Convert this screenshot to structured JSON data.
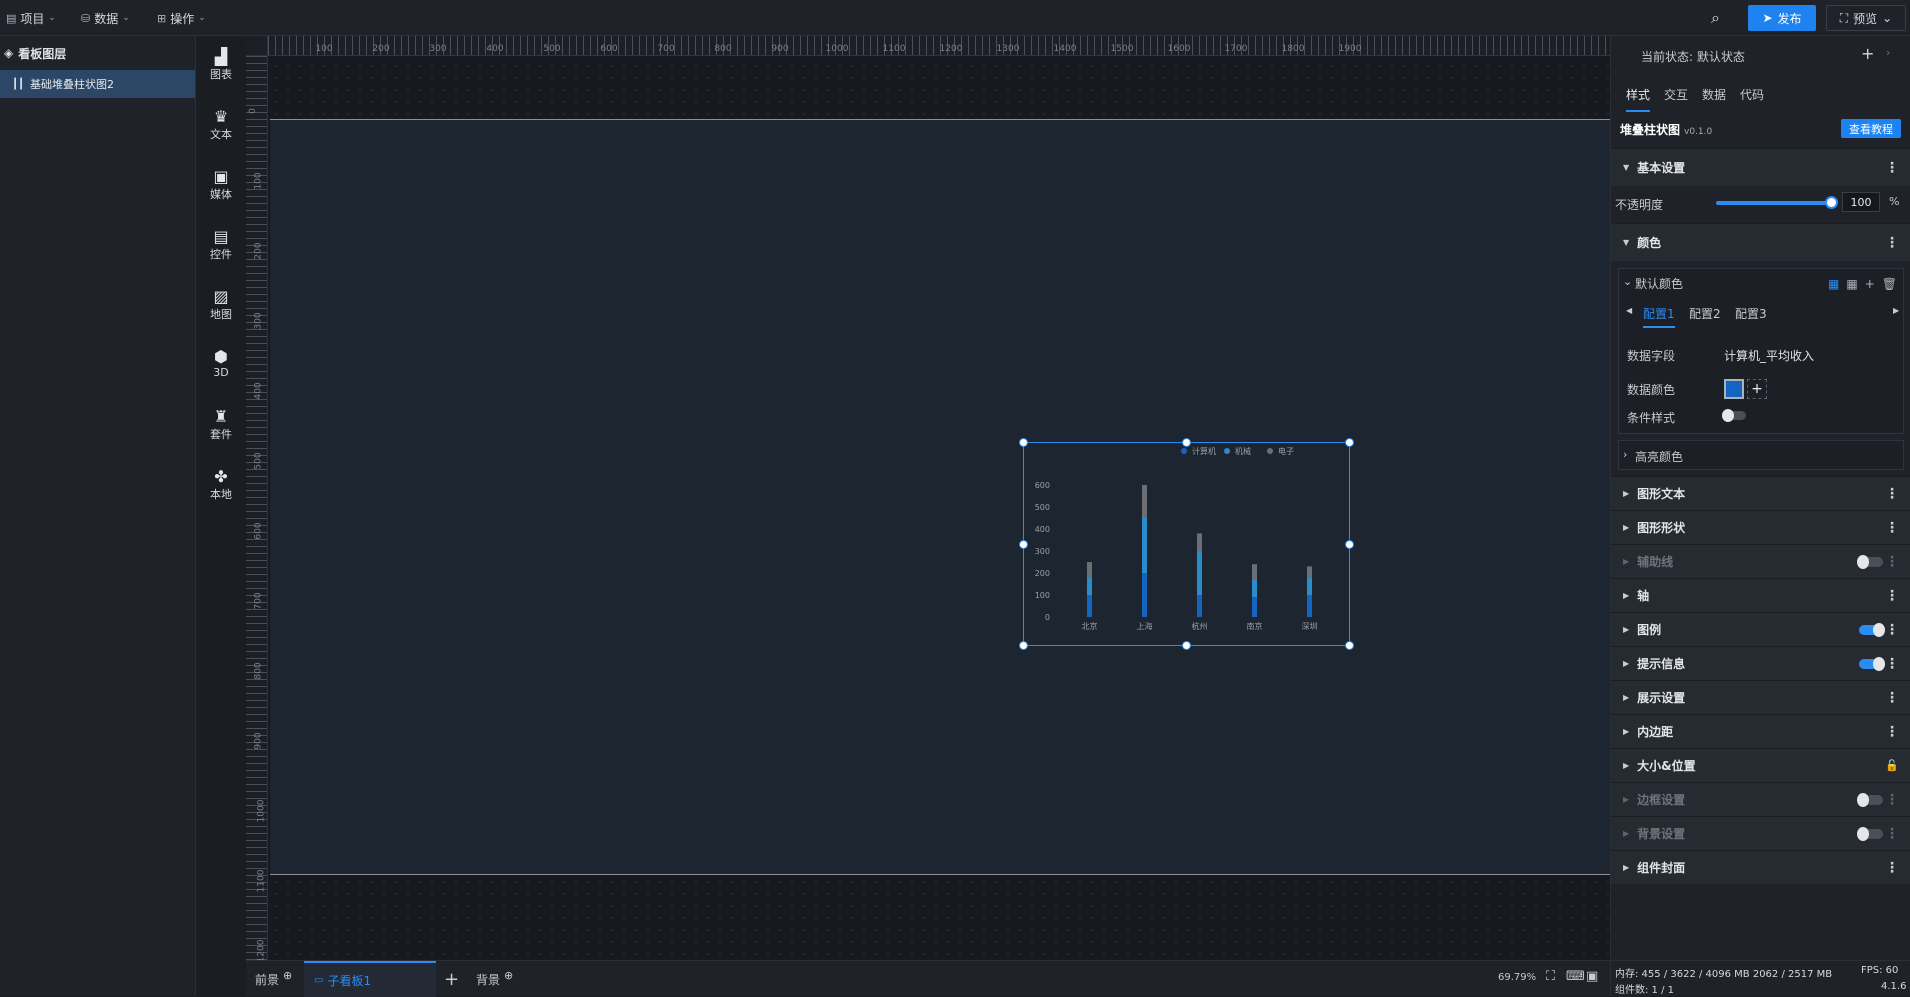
{
  "topbar": {
    "menu": [
      {
        "label": "项目"
      },
      {
        "label": "数据"
      },
      {
        "label": "操作"
      }
    ],
    "publish_label": "发布",
    "preview_label": "预览"
  },
  "left_panel": {
    "title": "看板图层",
    "layers": [
      {
        "label": "基础堆叠柱状图2"
      }
    ]
  },
  "tools": [
    {
      "label": "图表",
      "icon": "bar-chart-icon"
    },
    {
      "label": "文本",
      "icon": "text-icon"
    },
    {
      "label": "媒体",
      "icon": "media-icon"
    },
    {
      "label": "控件",
      "icon": "widget-icon"
    },
    {
      "label": "地图",
      "icon": "map-icon"
    },
    {
      "label": "3D",
      "icon": "cube-icon"
    },
    {
      "label": "套件",
      "icon": "shirt-icon"
    },
    {
      "label": "本地",
      "icon": "puzzle-icon"
    }
  ],
  "rulers": {
    "horizontal": [
      "100",
      "200",
      "300",
      "400",
      "500",
      "600",
      "700",
      "800",
      "900",
      "1000",
      "1100",
      "1200",
      "1300",
      "1400",
      "1500",
      "1600",
      "1700",
      "1800",
      "1900"
    ],
    "vertical": [
      "0",
      "100",
      "200",
      "300",
      "400",
      "500",
      "600",
      "700",
      "800",
      "900",
      "1000",
      "1100",
      "1200"
    ]
  },
  "chart_data": {
    "type": "bar",
    "stacked": true,
    "categories": [
      "北京",
      "上海",
      "杭州",
      "南京",
      "深圳"
    ],
    "series": [
      {
        "name": "计算机",
        "values": [
          100,
          200,
          100,
          90,
          100
        ],
        "color": "#1565c0"
      },
      {
        "name": "机械",
        "values": [
          80,
          250,
          200,
          80,
          80
        ],
        "color": "#2a8cc8"
      },
      {
        "name": "电子",
        "values": [
          70,
          150,
          80,
          70,
          50
        ],
        "color": "#6b6e73"
      }
    ],
    "yticks": [
      "0",
      "100",
      "200",
      "300",
      "400",
      "500",
      "600"
    ],
    "ylim": [
      0,
      600
    ],
    "legend_position": "top-right",
    "grid": false
  },
  "bottom": {
    "tabs": [
      {
        "label": "前景"
      },
      {
        "label": "子看板1"
      },
      {
        "label": "背景"
      }
    ],
    "zoom": "69.79%",
    "memory": "内存: 455 / 3622 / 4096 MB  2062 / 2517 MB",
    "fps": "FPS: 60",
    "components": "组件数: 1 / 1",
    "version": "4.1.6"
  },
  "right_panel": {
    "state": "当前状态: 默认状态",
    "tabs": [
      "样式",
      "交互",
      "数据",
      "代码"
    ],
    "component_name": "堆叠柱状图",
    "component_version": "v0.1.0",
    "tutorial_label": "查看教程",
    "basic_section": "基本设置",
    "opacity_label": "不透明度",
    "opacity_value": "100",
    "opacity_unit": "%",
    "color_section": "颜色",
    "default_color": "默认颜色",
    "config_tabs": [
      "配置1",
      "配置2",
      "配置3"
    ],
    "data_field_label": "数据字段",
    "data_field_value": "计算机_平均收入",
    "data_color_label": "数据颜色",
    "conditional_label": "条件样式",
    "highlight_color": "高亮颜色",
    "sections": [
      {
        "label": "图形文本",
        "state": "more"
      },
      {
        "label": "图形形状",
        "state": "more"
      },
      {
        "label": "辅助线",
        "state": "toggle-off",
        "dim": true
      },
      {
        "label": "轴",
        "state": "more"
      },
      {
        "label": "图例",
        "state": "toggle-on"
      },
      {
        "label": "提示信息",
        "state": "toggle-on"
      },
      {
        "label": "展示设置",
        "state": "more"
      },
      {
        "label": "内边距",
        "state": "more"
      },
      {
        "label": "大小&位置",
        "state": "lock"
      },
      {
        "label": "边框设置",
        "state": "toggle-off",
        "dim": true
      },
      {
        "label": "背景设置",
        "state": "toggle-off",
        "dim": true
      },
      {
        "label": "组件封面",
        "state": "more"
      }
    ]
  }
}
